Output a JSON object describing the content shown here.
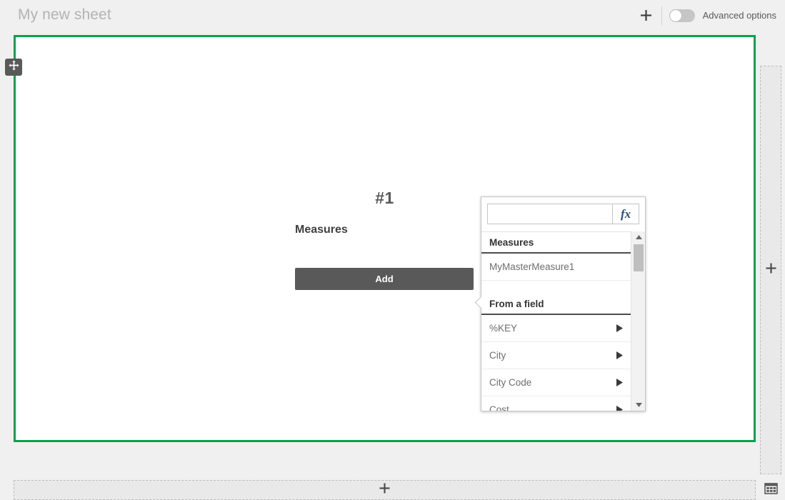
{
  "topbar": {
    "sheet_title": "My new sheet",
    "add_object_icon": "plus-icon",
    "advanced_options_label": "Advanced options",
    "advanced_options_state": "off"
  },
  "sheet": {
    "drag_handle_icon": "move-icon",
    "selection_color": "#0aa14f",
    "right_dropzone_icon": "plus-icon",
    "bottom_dropzone_icon": "plus-icon",
    "grid_toggle_icon": "grid-icon"
  },
  "chart_placeholder": {
    "number_label": "#1",
    "measures_label": "Measures",
    "add_button_label": "Add",
    "add_button_color": "#595959"
  },
  "measure_popover": {
    "search_value": "",
    "search_placeholder": "",
    "expression_button_label": "fx",
    "sections": [
      {
        "header": "Measures",
        "items": [
          {
            "label": "MyMasterMeasure1",
            "has_submenu": false
          }
        ]
      },
      {
        "header": "From a field",
        "items": [
          {
            "label": "%KEY",
            "has_submenu": true
          },
          {
            "label": "City",
            "has_submenu": true
          },
          {
            "label": "City Code",
            "has_submenu": true
          },
          {
            "label": "Cost",
            "has_submenu": true
          }
        ]
      }
    ],
    "scrollbar": {
      "up_icon": "caret-up-icon",
      "down_icon": "caret-down-icon"
    }
  }
}
